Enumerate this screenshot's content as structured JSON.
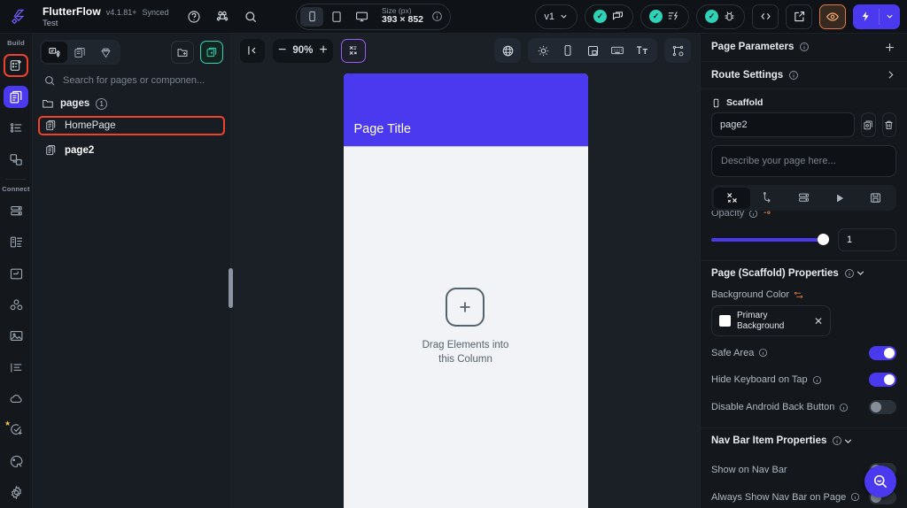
{
  "topbar": {
    "logo_icon": "flutterflow-logo-icon",
    "project_name": "FlutterFlow",
    "version": "v4.1.81+",
    "sync_status": "Synced",
    "branch": "Test",
    "help_icon": "help-circle-icon",
    "command_icon": "command-key-icon",
    "search_icon": "search-icon",
    "devices": [
      {
        "name": "phone",
        "icon": "phone-icon",
        "active": true
      },
      {
        "name": "tablet",
        "icon": "tablet-icon",
        "active": false
      },
      {
        "name": "desktop",
        "icon": "desktop-icon",
        "active": false
      }
    ],
    "size_label": "Size (px)",
    "size_value": "393 × 852",
    "size_info_icon": "info-icon",
    "version_pill": "v1",
    "chevron_icon": "chevron-down-icon",
    "status_pills": [
      {
        "name": "comments",
        "icon": "chat-bubble-icon",
        "checked": true
      },
      {
        "name": "performance",
        "icon": "lightning-lines-icon",
        "checked": true
      },
      {
        "name": "debug",
        "icon": "bug-icon",
        "checked": true
      }
    ],
    "code_icon": "code-brackets-icon",
    "open_external_icon": "open-external-icon",
    "preview_icon": "eye-icon",
    "run_icon": "lightning-bolt-icon",
    "run_chevron_icon": "chevron-down-icon"
  },
  "rail": {
    "build_label": "Build",
    "connect_label": "Connect",
    "build_items": [
      {
        "name": "add-page",
        "icon": "page-plus-icon",
        "highlighted": true
      },
      {
        "name": "page-selector",
        "icon": "pages-stack-icon",
        "selected": true
      },
      {
        "name": "widget-tree",
        "icon": "list-tree-icon"
      },
      {
        "name": "components",
        "icon": "components-icon"
      }
    ],
    "connect_items": [
      {
        "name": "database",
        "icon": "database-icon"
      },
      {
        "name": "collections",
        "icon": "collections-icon"
      },
      {
        "name": "storage",
        "icon": "folder-icon"
      },
      {
        "name": "integrations",
        "icon": "integrations-icon"
      },
      {
        "name": "media-assets",
        "icon": "image-icon"
      },
      {
        "name": "localization",
        "icon": "text-align-icon"
      },
      {
        "name": "api-calls",
        "icon": "cloud-icon"
      },
      {
        "name": "tests",
        "icon": "check-plus-icon",
        "starred": true
      },
      {
        "name": "theme",
        "icon": "palette-icon"
      },
      {
        "name": "settings",
        "icon": "gear-icon"
      }
    ]
  },
  "pages_panel": {
    "tabs": [
      {
        "name": "pages",
        "icon": "page-widget-icon",
        "active": true
      },
      {
        "name": "components",
        "icon": "component-icon",
        "active": false
      },
      {
        "name": "design-system",
        "icon": "diamond-icon",
        "active": false
      }
    ],
    "new_folder_icon": "folder-plus-icon",
    "add_page_icon": "add-page-icon",
    "search_icon": "search-icon",
    "search_placeholder": "Search for pages or componen...",
    "search_value": "",
    "folder_icon": "folder-open-icon",
    "folder_name": "pages",
    "folder_count": "1",
    "items": [
      {
        "name": "HomePage",
        "icon": "page-icon",
        "highlighted": true,
        "current": false
      },
      {
        "name": "page2",
        "icon": "page-icon",
        "highlighted": false,
        "current": true
      }
    ]
  },
  "canvas_toolbar": {
    "collapse_icon": "collapse-panel-icon",
    "zoom_out": "−",
    "zoom_level": "90%",
    "zoom_in": "+",
    "theme_toggle_icon": "theme-variant-icon",
    "right_tools": [
      {
        "name": "language",
        "icon": "globe-icon"
      },
      {
        "name": "brightness",
        "icon": "sun-icon"
      },
      {
        "name": "device-frame",
        "icon": "phone-icon"
      },
      {
        "name": "layout-split",
        "icon": "layout-icon"
      },
      {
        "name": "keyboard",
        "icon": "keyboard-icon"
      },
      {
        "name": "text-scale",
        "icon": "text-size-icon"
      },
      {
        "name": "widget-graph",
        "icon": "node-graph-icon"
      }
    ]
  },
  "canvas": {
    "app_bar_title": "Page Title",
    "app_bar_color": "#4b39ef",
    "page_background": "#f1f3f6",
    "drop_plus_icon": "plus-icon",
    "drop_text_line1": "Drag Elements into",
    "drop_text_line2": "this Column"
  },
  "right_panel": {
    "page_parameters_label": "Page Parameters",
    "page_parameters_info_icon": "info-icon",
    "add_parameter_icon": "plus-icon",
    "route_settings_label": "Route Settings",
    "route_settings_info_icon": "info-icon",
    "route_settings_chevron_icon": "chevron-right-icon",
    "scaffold_icon": "phone-icon",
    "scaffold_label": "Scaffold",
    "page_name_value": "page2",
    "copy_icon": "duplicate-icon",
    "delete_icon": "trash-icon",
    "description_placeholder": "Describe your page here...",
    "tabs": [
      {
        "name": "properties",
        "icon": "tools-icon",
        "active": true
      },
      {
        "name": "actions",
        "icon": "action-flow-icon",
        "active": false
      },
      {
        "name": "backend-query",
        "icon": "database-icon",
        "active": false
      },
      {
        "name": "animations",
        "icon": "play-icon",
        "active": false
      },
      {
        "name": "state",
        "icon": "save-state-icon",
        "active": false
      }
    ],
    "opacity_label": "Opacity",
    "opacity_info_icon": "info-icon",
    "opacity_variable_icon": "variable-icon",
    "opacity_value": "1",
    "scaffold_section": {
      "title": "Page (Scaffold) Properties",
      "info_icon": "info-icon",
      "chevron_icon": "chevron-down-icon",
      "background_color_label": "Background Color",
      "background_color_variable_icon": "variable-icon",
      "background_color_swatch": "#ffffff",
      "background_color_name": "Primary Background",
      "background_color_clear_icon": "close-icon",
      "toggles": [
        {
          "label": "Safe Area",
          "info": true,
          "on": true
        },
        {
          "label": "Hide Keyboard on Tap",
          "info": true,
          "on": true
        },
        {
          "label": "Disable Android Back Button",
          "info": true,
          "on": false
        }
      ]
    },
    "navbar_section": {
      "title": "Nav Bar Item Properties",
      "info_icon": "info-icon",
      "chevron_icon": "chevron-down-icon",
      "toggles": [
        {
          "label": "Show on Nav Bar",
          "info": false,
          "on": false
        },
        {
          "label": "Always Show Nav Bar on Page",
          "info": true,
          "on": false
        }
      ]
    },
    "fab_icon": "search-zoom-icon"
  }
}
